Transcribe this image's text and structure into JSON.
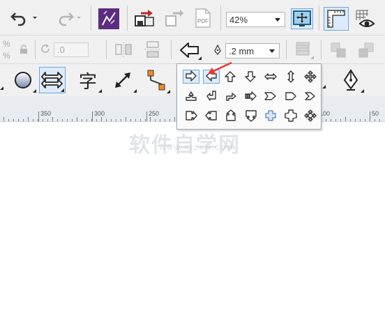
{
  "toolbar": {
    "zoom_value": "42%",
    "rotation_value": ".0",
    "outline_width_value": ".2 mm",
    "pdf_label": "PDF",
    "text_tool_glyph": "字",
    "left_edge_labels": [
      "%",
      "%"
    ]
  },
  "ruler": {
    "labels": [
      "350",
      "300",
      "250",
      "100",
      "50"
    ]
  },
  "arrowhead_flyout": {
    "title": "arrowhead-presets",
    "rows": [
      [
        "arrow-right-outline",
        "arrow-left-outline",
        "arrow-up-outline",
        "arrow-down-outline",
        "arrow-left-right",
        "arrow-up-down",
        "arrow-four-way"
      ],
      [
        "arrow-bent-up",
        "arrow-bent-left-up",
        "arrow-bent-right-up",
        "arrow-striped-right",
        "arrow-chevron-notch",
        "arrow-pentagon",
        "arrow-chevron"
      ],
      [
        "callout-right",
        "callout-left",
        "callout-up",
        "callout-down",
        "cross-rounded",
        "cross-octagon",
        "cross-arrows"
      ]
    ],
    "selected_index": 0
  },
  "colors": {
    "toolbar_bg": "#f0f0f0",
    "ruler_bg": "#e8ecf1",
    "selection": "#dcebfb",
    "callout_red": "#e8382f",
    "corel_purple": "#5b2d82",
    "node_orange": "#f08a1c"
  },
  "watermark": {
    "main": "软件自学网",
    "sub": "WWW.RJZXW.COM"
  }
}
